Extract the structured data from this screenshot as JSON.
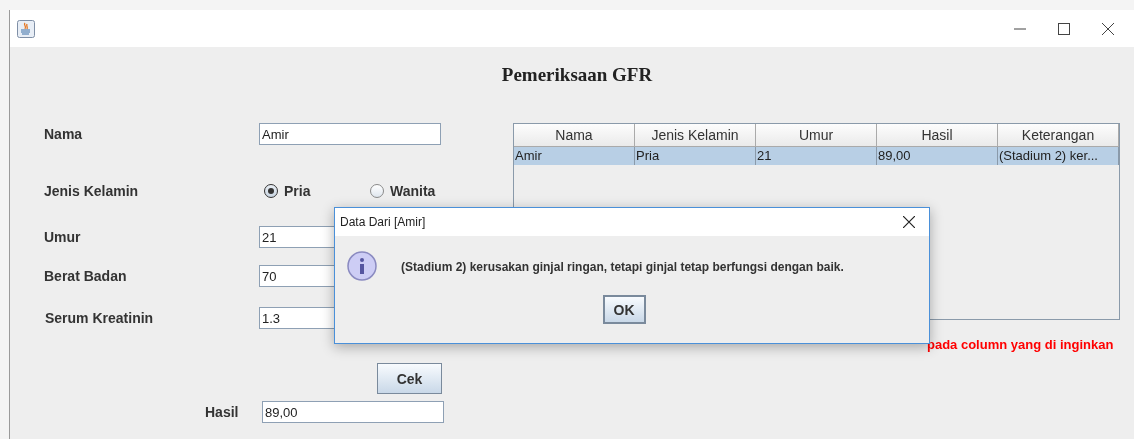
{
  "heading": "Pemeriksaan GFR",
  "form": {
    "nama_label": "Nama",
    "nama_value": "Amir",
    "gender_label": "Jenis Kelamin",
    "gender_options": [
      {
        "label": "Pria",
        "selected": true
      },
      {
        "label": "Wanita",
        "selected": false
      }
    ],
    "umur_label": "Umur",
    "umur_value": "21",
    "berat_label": "Berat Badan",
    "berat_value": "70",
    "serum_label": "Serum Kreatinin",
    "serum_value": "1.3",
    "button": "Cek",
    "hasil_label": "Hasil",
    "hasil_value": "89,00"
  },
  "table": {
    "columns": [
      "Nama",
      "Jenis Kelamin",
      "Umur",
      "Hasil",
      "Keterangan"
    ],
    "rows": [
      {
        "cells": [
          "Amir",
          "Pria",
          "21",
          "89,00",
          "(Stadium 2) ker..."
        ],
        "selected": true
      }
    ]
  },
  "note": "pada column yang di inginkan",
  "dialog": {
    "title": "Data Dari [Amir]",
    "message": "(Stadium 2) kerusakan ginjal ringan, tetapi ginjal tetap berfungsi dengan baik.",
    "button": "OK"
  }
}
